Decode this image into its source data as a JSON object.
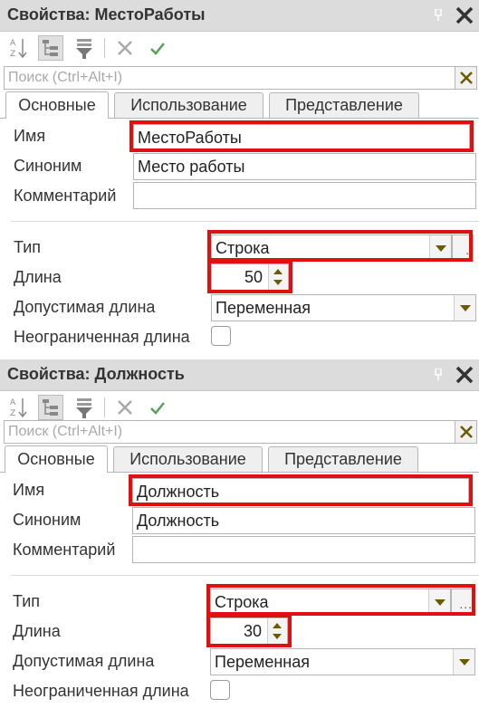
{
  "panels": [
    {
      "title": "Свойства: МестоРаботы",
      "search_placeholder": "Поиск (Ctrl+Alt+I)",
      "tabs": [
        "Основные",
        "Использование",
        "Представление"
      ],
      "fields": {
        "name_label": "Имя",
        "name_value": "МестоРаботы",
        "synonym_label": "Синоним",
        "synonym_value": "Место работы",
        "comment_label": "Комментарий",
        "comment_value": "",
        "type_label": "Тип",
        "type_value": "Строка",
        "length_label": "Длина",
        "length_value": "50",
        "allowed_length_label": "Допустимая длина",
        "allowed_length_value": "Переменная",
        "unlimited_label": "Неограниченная длина",
        "unlimited_checked": false
      }
    },
    {
      "title": "Свойства: Должность",
      "search_placeholder": "Поиск (Ctrl+Alt+I)",
      "tabs": [
        "Основные",
        "Использование",
        "Представление"
      ],
      "fields": {
        "name_label": "Имя",
        "name_value": "Должность",
        "synonym_label": "Синоним",
        "synonym_value": "Должность",
        "comment_label": "Комментарий",
        "comment_value": "",
        "type_label": "Тип",
        "type_value": "Строка",
        "length_label": "Длина",
        "length_value": "30",
        "allowed_length_label": "Допустимая длина",
        "allowed_length_value": "Переменная",
        "unlimited_label": "Неограниченная длина",
        "unlimited_checked": false
      }
    }
  ],
  "icons": {
    "sort": "sort-alphabetical-icon",
    "tree": "tree-view-icon",
    "filter": "filter-icon",
    "cancel": "cancel-x-icon",
    "apply": "check-icon",
    "pin": "pin-icon",
    "close": "close-icon"
  },
  "colors": {
    "highlight": "#e01010",
    "titlebar": "#dcdcdc",
    "dropdown_arrow": "#6a5a00",
    "check_green": "#5aa05a"
  }
}
